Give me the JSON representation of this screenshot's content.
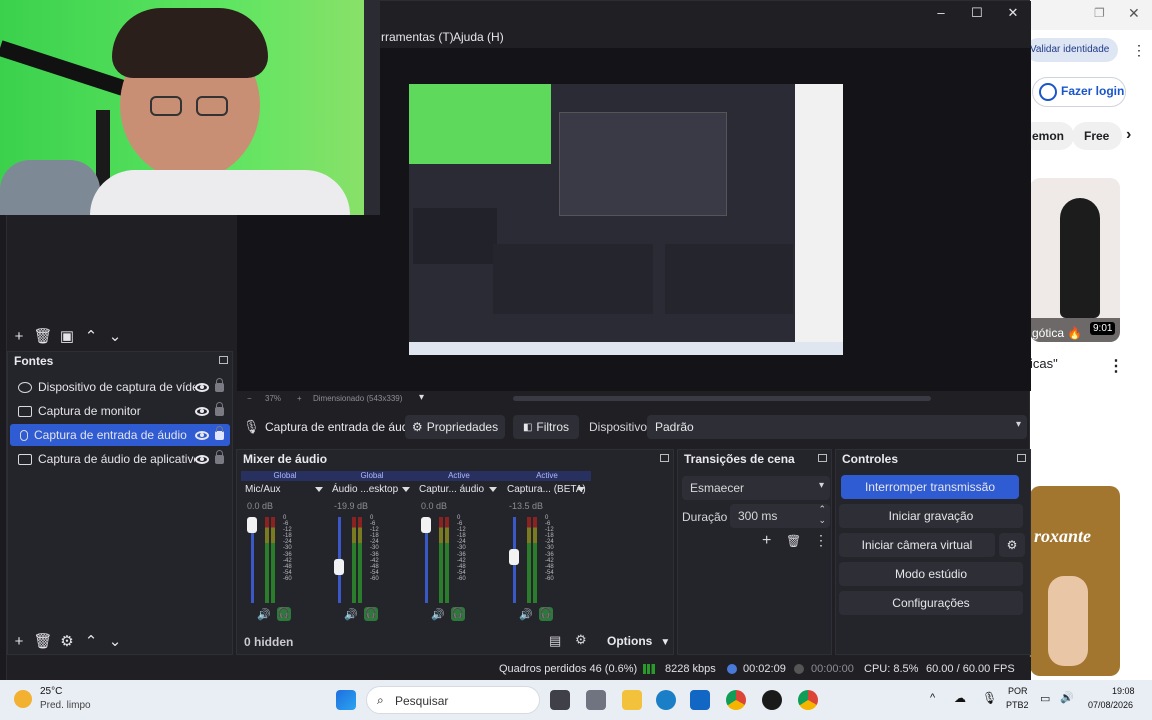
{
  "browser": {
    "verify_label": "Validar identidade",
    "login_label": "Fazer login",
    "chip_1": "emon",
    "chip_2": "Free",
    "video_title_1": "gótica 🔥",
    "video_duration_1": "9:01",
    "video_title_2": "icas\"",
    "video_text_overlay": "roxante"
  },
  "obs": {
    "menu": {
      "tools": "rramentas (T)",
      "help": "Ajuda (H)"
    },
    "preview_zoom": "37%",
    "preview_scaled": "Dimensionado (543x339)",
    "source_toolbar": {
      "source_name": "Captura de entrada de áud",
      "properties": "Propriedades",
      "filters": "Filtros",
      "device_label": "Dispositivo",
      "device_value": "Padrão"
    },
    "sources": {
      "title": "Fontes",
      "items": [
        {
          "label": "Dispositivo de captura de vídeo",
          "icon": "camera-icon"
        },
        {
          "label": "Captura de monitor",
          "icon": "monitor-icon"
        },
        {
          "label": "Captura de entrada de áudio",
          "icon": "mic-icon",
          "selected": true
        },
        {
          "label": "Captura de áudio de aplicativo (",
          "icon": "app-audio-icon"
        }
      ]
    },
    "mixer": {
      "title": "Mixer de áudio",
      "channels": [
        {
          "tag": "Global",
          "name": "Mic/Aux",
          "db": "0.0 dB",
          "level": 1.0
        },
        {
          "tag": "Global",
          "name": "Áudio ...esktop",
          "db": "-19.9 dB",
          "level": 0.4
        },
        {
          "tag": "Active",
          "name": "Captur... áudio",
          "db": "0.0 dB",
          "level": 1.0
        },
        {
          "tag": "Active",
          "name": "Captura... (BETA)",
          "db": "-13.5 dB",
          "level": 0.55
        }
      ],
      "scale": [
        "0",
        "-6",
        "-12",
        "-18",
        "-24",
        "-30",
        "-36",
        "-42",
        "-48",
        "-54",
        "-60"
      ],
      "hidden": "0 hidden",
      "options": "Options"
    },
    "transitions": {
      "title": "Transições de cena",
      "type": "Esmaecer",
      "duration_label": "Duração",
      "duration_value": "300 ms"
    },
    "controls": {
      "title": "Controles",
      "stop_stream": "Interromper transmissão",
      "start_record": "Iniciar gravação",
      "virtual_cam": "Iniciar câmera virtual",
      "studio_mode": "Modo estúdio",
      "settings": "Configurações"
    },
    "status": {
      "dropped": "Quadros perdidos 46 (0.6%)",
      "kbps": "8228 kbps",
      "stream_time": "00:02:09",
      "rec_time": "00:00:00",
      "cpu": "CPU: 8.5%",
      "fps": "60.00 / 60.00 FPS"
    },
    "colors": {
      "accent": "#2f5bd3",
      "meter_green": "#2a7d2a",
      "bg": "#1f1f24"
    }
  },
  "taskbar": {
    "weather_temp": "25°C",
    "weather_desc": "Pred. limpo",
    "search_placeholder": "Pesquisar",
    "lang_1": "POR",
    "lang_2": "PTB2",
    "time": "19:08",
    "date": "07/08/2026"
  }
}
